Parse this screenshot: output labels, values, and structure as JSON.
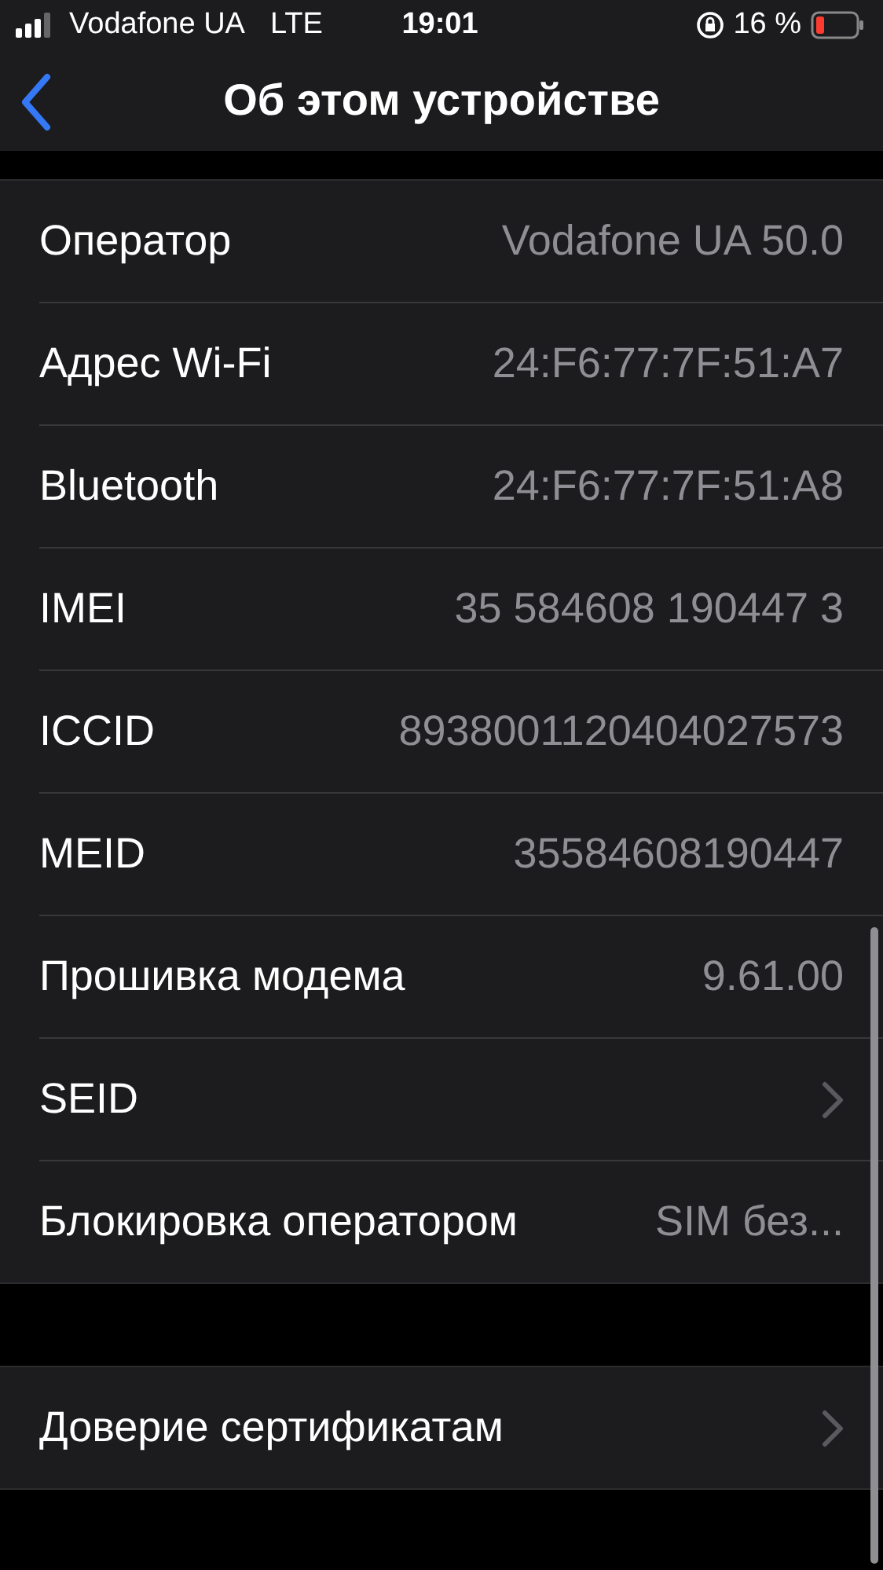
{
  "status_bar": {
    "carrier": "Vodafone UA",
    "network": "LTE",
    "time": "19:01",
    "battery": "16 %"
  },
  "nav": {
    "title": "Об этом устройстве"
  },
  "sections": [
    {
      "rows": [
        {
          "kind": "value",
          "label": "Оператор",
          "value": "Vodafone UA 50.0"
        },
        {
          "kind": "value",
          "label": "Адрес Wi-Fi",
          "value": "24:F6:77:7F:51:A7"
        },
        {
          "kind": "value",
          "label": "Bluetooth",
          "value": "24:F6:77:7F:51:A8"
        },
        {
          "kind": "value",
          "label": "IMEI",
          "value": "35 584608 190447 3"
        },
        {
          "kind": "value",
          "label": "ICCID",
          "value": "8938001120404027573"
        },
        {
          "kind": "value",
          "label": "MEID",
          "value": "35584608190447"
        },
        {
          "kind": "value",
          "label": "Прошивка модема",
          "value": "9.61.00"
        },
        {
          "kind": "link",
          "label": "SEID"
        },
        {
          "kind": "value",
          "label": "Блокировка оператором",
          "value": "SIM без..."
        }
      ]
    },
    {
      "rows": [
        {
          "kind": "link",
          "label": "Доверие сертификатам"
        }
      ]
    }
  ]
}
